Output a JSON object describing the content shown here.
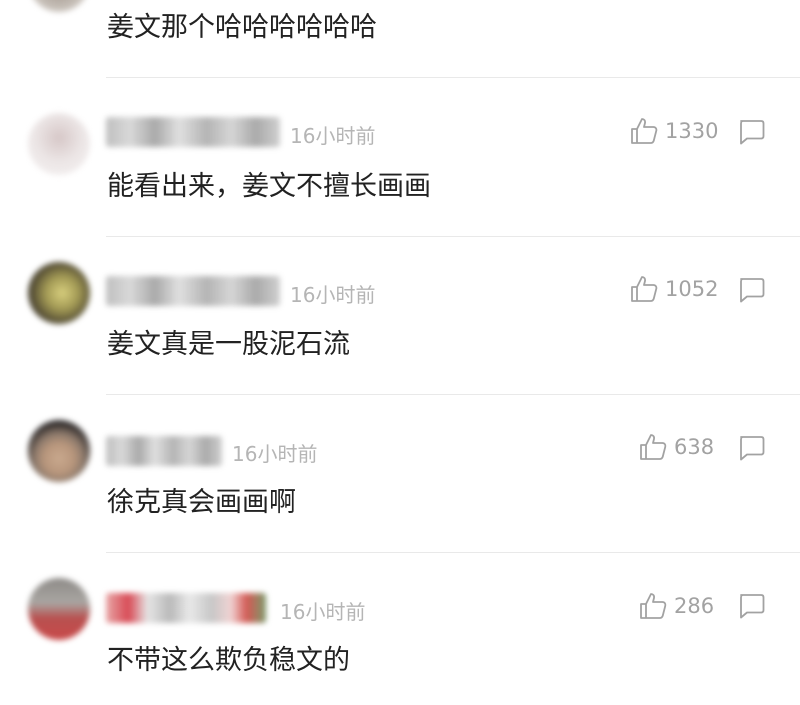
{
  "comments": [
    {
      "name": "",
      "time": "",
      "text": "姜文那个哈哈哈哈哈哈",
      "likes": ""
    },
    {
      "name": "",
      "time": "16小时前",
      "text": "能看出来，姜文不擅长画画",
      "likes": "1330"
    },
    {
      "name": "",
      "time": "16小时前",
      "text": "姜文真是一股泥石流",
      "likes": "1052"
    },
    {
      "name": "",
      "time": "16小时前",
      "text": "徐克真会画画啊",
      "likes": "638"
    },
    {
      "name": "",
      "time": "16小时前",
      "text": "不带这么欺负稳文的",
      "likes": "286"
    }
  ],
  "icons": {
    "like": "thumbs-up-icon",
    "reply": "comment-bubble-icon"
  },
  "colors": {
    "text": "#222222",
    "meta": "#b5b5b5",
    "count": "#a2a2a2",
    "divider": "#e9e9e9"
  }
}
